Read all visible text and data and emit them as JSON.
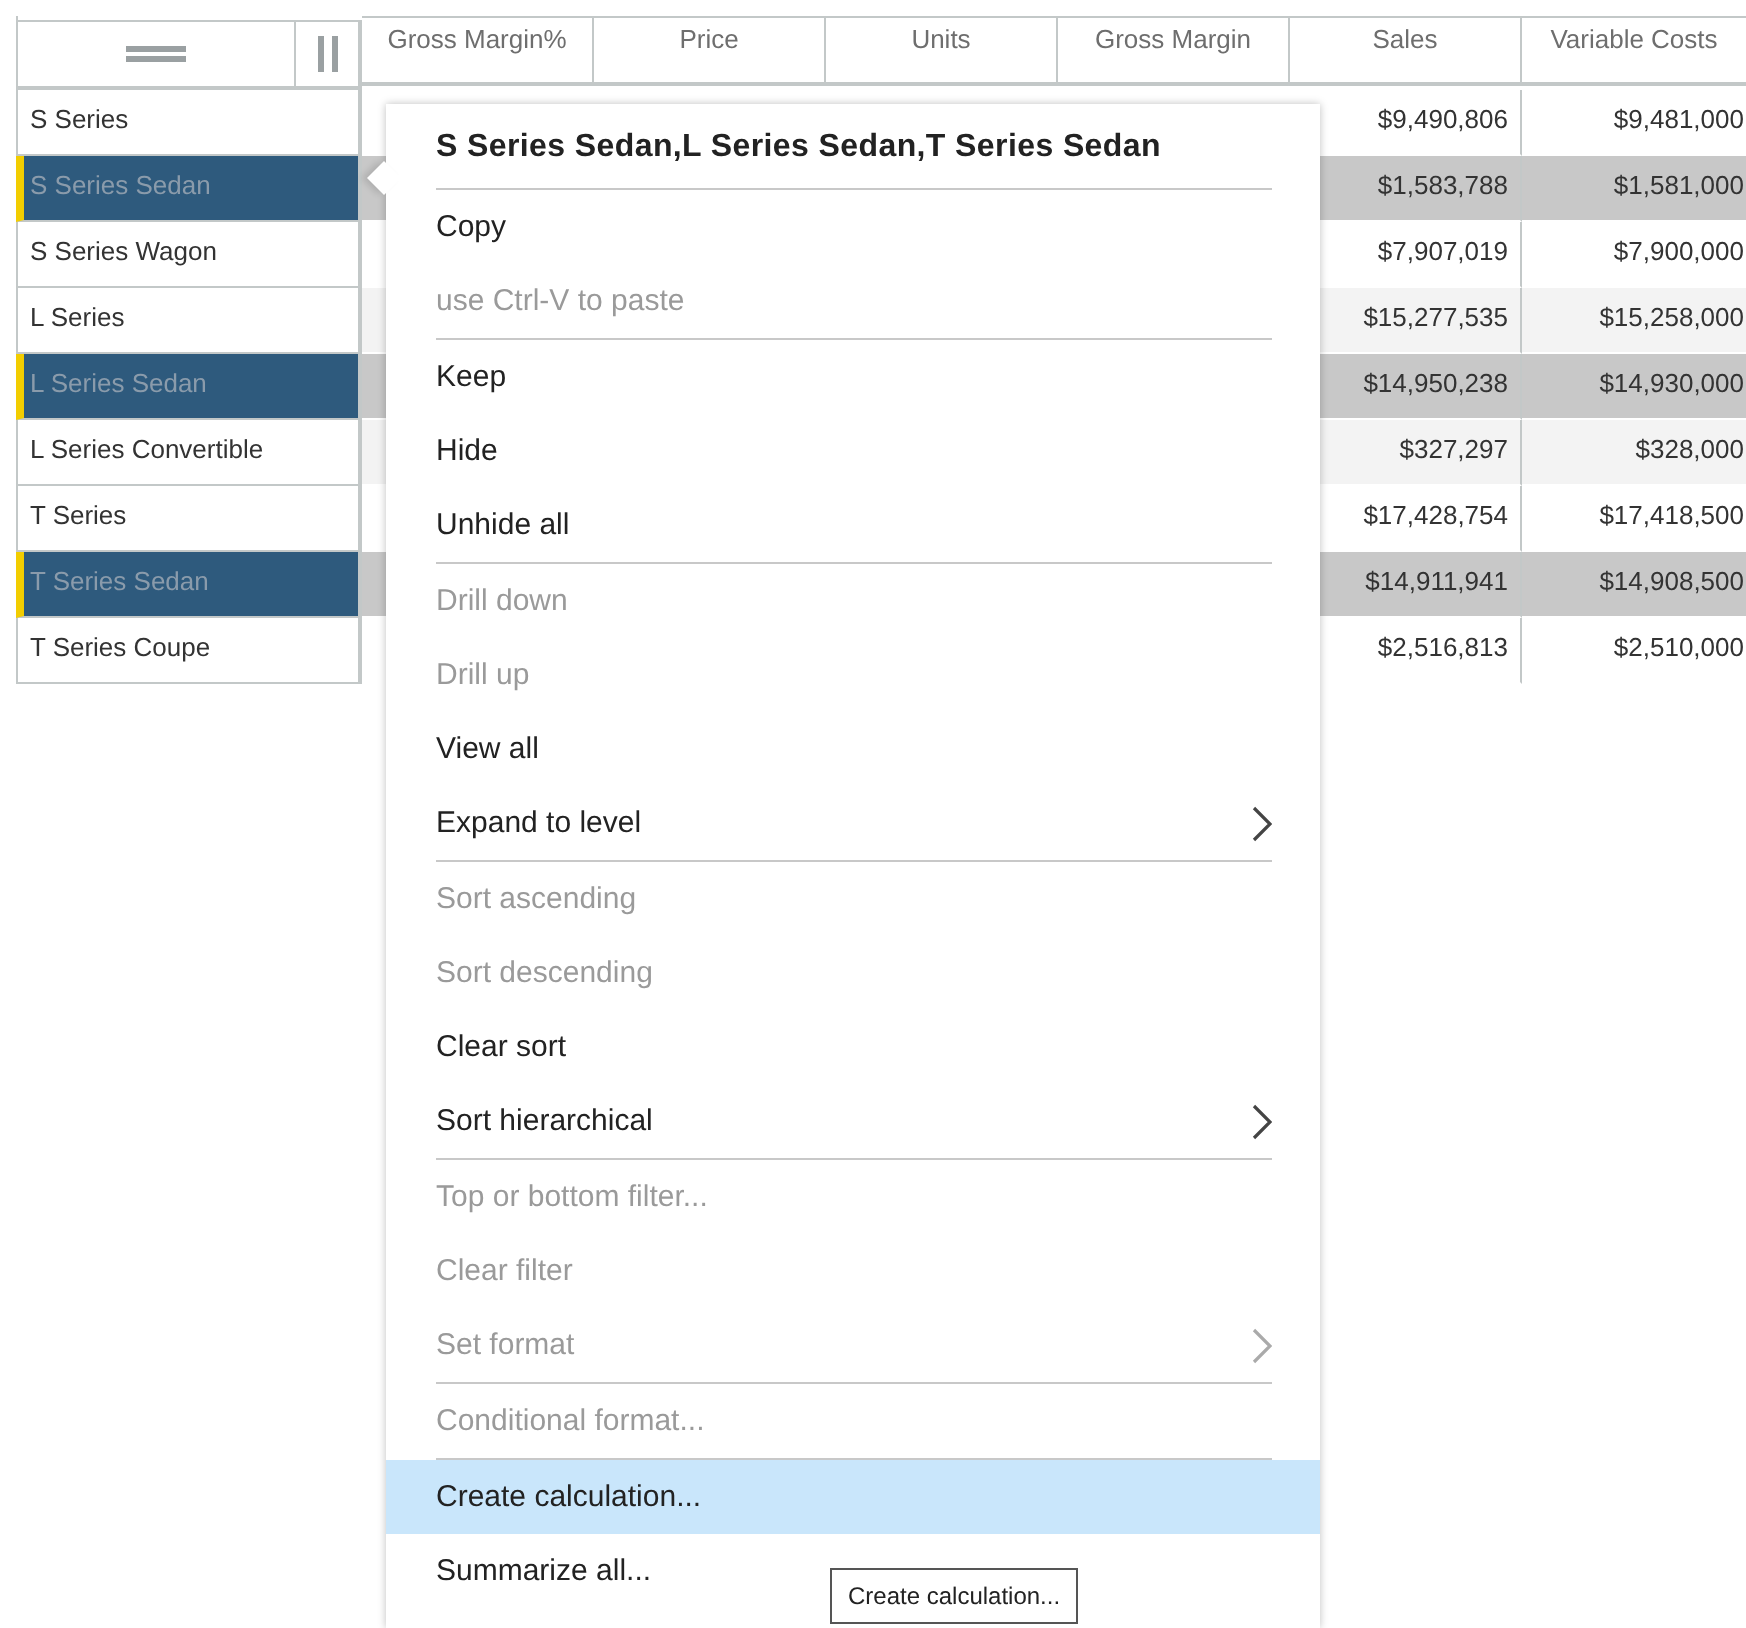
{
  "table": {
    "columns": [
      "Gross Margin%",
      "Price",
      "Units",
      "Gross Margin",
      "Sales",
      "Variable Costs"
    ],
    "rows": [
      {
        "label": "S Series",
        "selected": false,
        "shaded": false,
        "sales": "$9,490,806",
        "variable_costs": "$9,481,000"
      },
      {
        "label": "S Series Sedan",
        "selected": true,
        "shaded": false,
        "sales": "$1,583,788",
        "variable_costs": "$1,581,000"
      },
      {
        "label": "S Series Wagon",
        "selected": false,
        "shaded": false,
        "sales": "$7,907,019",
        "variable_costs": "$7,900,000"
      },
      {
        "label": "L Series",
        "selected": false,
        "shaded": true,
        "sales": "$15,277,535",
        "variable_costs": "$15,258,000"
      },
      {
        "label": "L Series Sedan",
        "selected": true,
        "shaded": false,
        "sales": "$14,950,238",
        "variable_costs": "$14,930,000"
      },
      {
        "label": "L Series Convertible",
        "selected": false,
        "shaded": true,
        "sales": "$327,297",
        "variable_costs": "$328,000"
      },
      {
        "label": "T Series",
        "selected": false,
        "shaded": false,
        "sales": "$17,428,754",
        "variable_costs": "$17,418,500"
      },
      {
        "label": "T Series Sedan",
        "selected": true,
        "shaded": false,
        "sales": "$14,911,941",
        "variable_costs": "$14,908,500"
      },
      {
        "label": "T Series Coupe",
        "selected": false,
        "shaded": false,
        "sales": "$2,516,813",
        "variable_costs": "$2,510,000"
      }
    ]
  },
  "menu": {
    "title": "S Series Sedan,L Series Sedan,T Series Sedan",
    "groups": [
      [
        {
          "label": "Copy",
          "disabled": false,
          "submenu": false,
          "highlighted": false
        },
        {
          "label": "use Ctrl-V to paste",
          "disabled": true,
          "submenu": false,
          "highlighted": false
        }
      ],
      [
        {
          "label": "Keep",
          "disabled": false,
          "submenu": false,
          "highlighted": false
        },
        {
          "label": "Hide",
          "disabled": false,
          "submenu": false,
          "highlighted": false
        },
        {
          "label": "Unhide all",
          "disabled": false,
          "submenu": false,
          "highlighted": false
        }
      ],
      [
        {
          "label": "Drill down",
          "disabled": true,
          "submenu": false,
          "highlighted": false
        },
        {
          "label": "Drill up",
          "disabled": true,
          "submenu": false,
          "highlighted": false
        },
        {
          "label": "View all",
          "disabled": false,
          "submenu": false,
          "highlighted": false
        },
        {
          "label": "Expand to level",
          "disabled": false,
          "submenu": true,
          "highlighted": false
        }
      ],
      [
        {
          "label": "Sort ascending",
          "disabled": true,
          "submenu": false,
          "highlighted": false
        },
        {
          "label": "Sort descending",
          "disabled": true,
          "submenu": false,
          "highlighted": false
        },
        {
          "label": "Clear sort",
          "disabled": false,
          "submenu": false,
          "highlighted": false
        },
        {
          "label": "Sort hierarchical",
          "disabled": false,
          "submenu": true,
          "highlighted": false
        }
      ],
      [
        {
          "label": "Top or bottom filter...",
          "disabled": true,
          "submenu": false,
          "highlighted": false
        },
        {
          "label": "Clear filter",
          "disabled": true,
          "submenu": false,
          "highlighted": false
        },
        {
          "label": "Set format",
          "disabled": true,
          "submenu": true,
          "highlighted": false
        }
      ],
      [
        {
          "label": "Conditional format...",
          "disabled": true,
          "submenu": false,
          "highlighted": false
        }
      ],
      [
        {
          "label": "Create calculation...",
          "disabled": false,
          "submenu": false,
          "highlighted": true
        },
        {
          "label": "Summarize all...",
          "disabled": false,
          "submenu": false,
          "highlighted": false
        }
      ]
    ],
    "tooltip": "Create calculation..."
  }
}
